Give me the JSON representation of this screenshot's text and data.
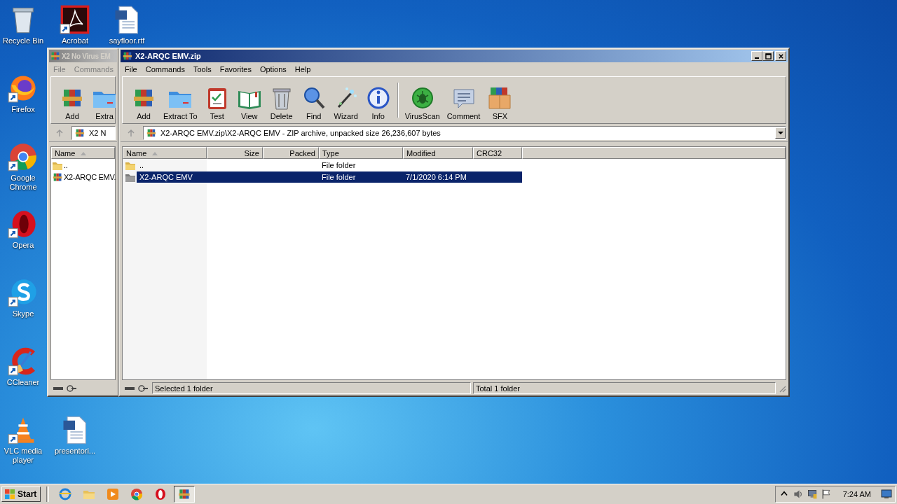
{
  "desktop_icons": [
    {
      "label": "Recycle Bin"
    },
    {
      "label": "Acrobat"
    },
    {
      "label": "sayfloor.rtf"
    },
    {
      "label": "Firefox"
    },
    {
      "label": "Google Chrome"
    },
    {
      "label": "Opera"
    },
    {
      "label": "Skype"
    },
    {
      "label": "CCleaner"
    },
    {
      "label": "VLC media player"
    },
    {
      "label": "presentori..."
    }
  ],
  "back_window": {
    "title": "X2 No Virus EM",
    "menu": [
      "File",
      "Commands"
    ],
    "toolbar": [
      "Add",
      "Extra"
    ],
    "address": "X2 N",
    "columns": [
      {
        "label": "Name",
        "sorted": true
      }
    ],
    "rows": [
      {
        "name": ".."
      },
      {
        "name": "X2-ARQC EMV."
      }
    ]
  },
  "front_window": {
    "title": "X2-ARQC EMV.zip",
    "menu": [
      "File",
      "Commands",
      "Tools",
      "Favorites",
      "Options",
      "Help"
    ],
    "toolbar": [
      {
        "label": "Add",
        "separator_before": false
      },
      {
        "label": "Extract To",
        "separator_before": false
      },
      {
        "label": "Test",
        "separator_before": false
      },
      {
        "label": "View",
        "separator_before": false
      },
      {
        "label": "Delete",
        "separator_before": false
      },
      {
        "label": "Find",
        "separator_before": false
      },
      {
        "label": "Wizard",
        "separator_before": false
      },
      {
        "label": "Info",
        "separator_before": false
      },
      {
        "label": "VirusScan",
        "separator_before": true
      },
      {
        "label": "Comment",
        "separator_before": false
      },
      {
        "label": "SFX",
        "separator_before": false
      }
    ],
    "address": "X2-ARQC EMV.zip\\X2-ARQC EMV - ZIP archive, unpacked size 26,236,607 bytes",
    "columns": [
      {
        "label": "Name",
        "sorted": true
      },
      {
        "label": "Size",
        "sorted": false
      },
      {
        "label": "Packed",
        "sorted": false
      },
      {
        "label": "Type",
        "sorted": false
      },
      {
        "label": "Modified",
        "sorted": false
      },
      {
        "label": "CRC32",
        "sorted": false
      }
    ],
    "rows": [
      {
        "name": "..",
        "type": "File folder",
        "selected": false
      },
      {
        "name": "X2-ARQC EMV",
        "type": "File folder",
        "modified": "7/1/2020 6:14 PM",
        "selected": true
      }
    ],
    "status": [
      "Selected 1 folder",
      "Total 1 folder"
    ]
  },
  "taskbar": {
    "start": "Start",
    "items": [
      {
        "selected": false
      },
      {
        "selected": false
      },
      {
        "selected": false
      },
      {
        "selected": false
      },
      {
        "selected": false
      },
      {
        "selected": true
      }
    ],
    "clock": "7:24 AM"
  }
}
